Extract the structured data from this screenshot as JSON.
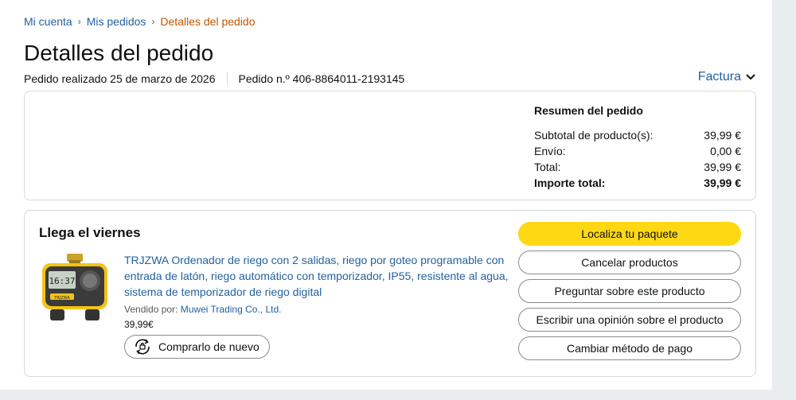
{
  "breadcrumb": {
    "items": [
      "Mi cuenta",
      "Mis pedidos"
    ],
    "current": "Detalles del pedido",
    "separator": "›"
  },
  "page_title": "Detalles del pedido",
  "order": {
    "placed": "Pedido realizado 25 de marzo de 2026",
    "number": "Pedido n.º 406-8864011-2193145"
  },
  "invoice": {
    "label": "Factura",
    "icon": "chevron-down-icon"
  },
  "summary": {
    "title": "Resumen del pedido",
    "rows": [
      {
        "label": "Subtotal de producto(s):",
        "value": "39,99 €"
      },
      {
        "label": "Envío:",
        "value": "0,00 €"
      },
      {
        "label": "Total:",
        "value": "39,99 €"
      },
      {
        "label": "Importe total:",
        "value": "39,99 €"
      }
    ]
  },
  "delivery": {
    "title": "Llega el viernes",
    "product": {
      "title": "TRJZWA Ordenador de riego con 2 salidas, riego por goteo programable con entrada de latón, riego automático con temporizador, IP55, resistente al agua, sistema de temporizador de riego digital",
      "sold_by_label": "Vendido por:",
      "seller": "Muwei Trading Co., Ltd.",
      "price": "39,99€",
      "buy_again": "Comprarlo de nuevo",
      "image_display": "16:37",
      "image_brand": "TRJZWA"
    },
    "actions": [
      "Localiza tu paquete",
      "Cancelar productos",
      "Preguntar sobre este producto",
      "Escribir una opinión sobre el producto",
      "Cambiar método de pago"
    ]
  },
  "colors": {
    "link": "#2162a1",
    "breadcrumb_current": "#c45500",
    "primary_button": "#ffd814",
    "border": "#d5d9d9",
    "background": "#eaeded"
  }
}
